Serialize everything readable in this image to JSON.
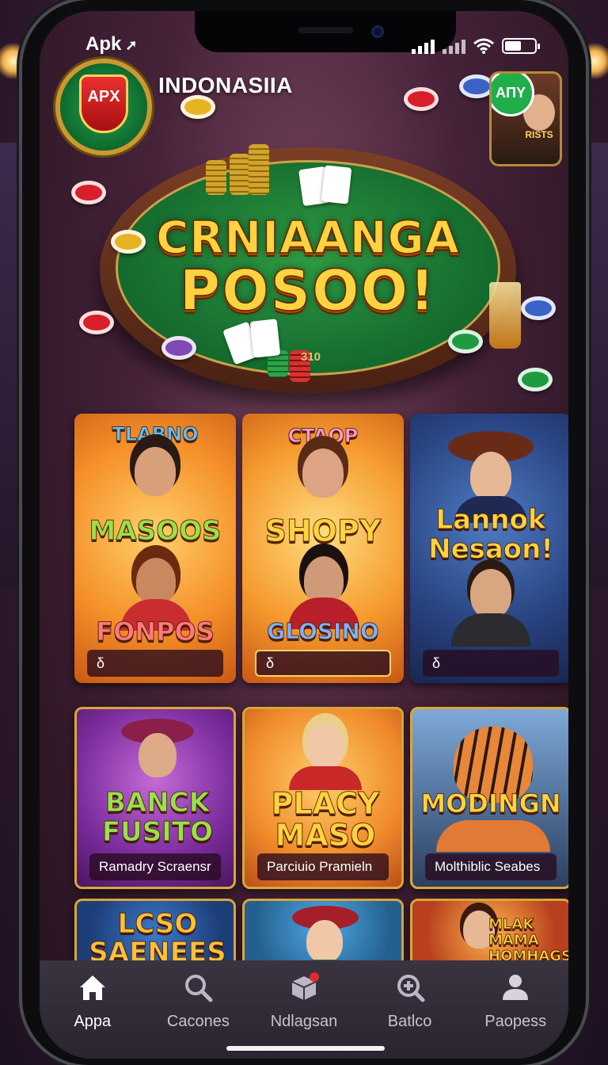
{
  "status_bar": {
    "carrier": "Apk",
    "battery_level": 0.55
  },
  "header": {
    "logo_text": "APX",
    "region_title": "INDONASIIA",
    "promo_badge": "AΠY",
    "promo_text": "RISTS"
  },
  "hero": {
    "title_line1": "CRNIAANGA",
    "title_line2": "POSOO!",
    "table_number": "310",
    "colors": {
      "felt": "#177030",
      "title": "#ffd23f"
    }
  },
  "games": [
    {
      "title_top": "TLABNO",
      "title_mid": "MASOOS",
      "title_bottom": "FONPOS",
      "caption": "δ"
    },
    {
      "title_top": "CTAOP",
      "title_mid": "SHOPY",
      "title_bottom": "GLOSINO",
      "caption": "δ"
    },
    {
      "title_top": "",
      "title_mid": "Lannok Nesaon!",
      "title_bottom": "",
      "caption": "δ"
    },
    {
      "title_top": "",
      "title_mid": "BANCK FUSITO",
      "title_bottom": "",
      "caption": "Ramadry Scraensr"
    },
    {
      "title_top": "",
      "title_mid": "PLACY MASO",
      "title_bottom": "",
      "caption": "Parciuio Pramieln"
    },
    {
      "title_top": "",
      "title_mid": "MODINGN",
      "title_bottom": "",
      "caption": "Molthiblic Seabes"
    },
    {
      "title_top": "",
      "title_mid": "LCSO SAENEES",
      "title_bottom": "",
      "caption": ""
    },
    {
      "title_top": "",
      "title_mid": "",
      "title_bottom": "",
      "caption": ""
    },
    {
      "title_top": "",
      "title_mid": "MLAK MAMA HOMHAGS",
      "title_bottom": "",
      "caption": ""
    }
  ],
  "nav": {
    "items": [
      {
        "label": "Appa",
        "icon": "home-icon",
        "active": true
      },
      {
        "label": "Cacones",
        "icon": "search-icon",
        "active": false
      },
      {
        "label": "Ndlagsan",
        "icon": "package-icon",
        "active": false
      },
      {
        "label": "Batlco",
        "icon": "zoom-plus-icon",
        "active": false
      },
      {
        "label": "Paopess",
        "icon": "person-icon",
        "active": false
      }
    ]
  }
}
